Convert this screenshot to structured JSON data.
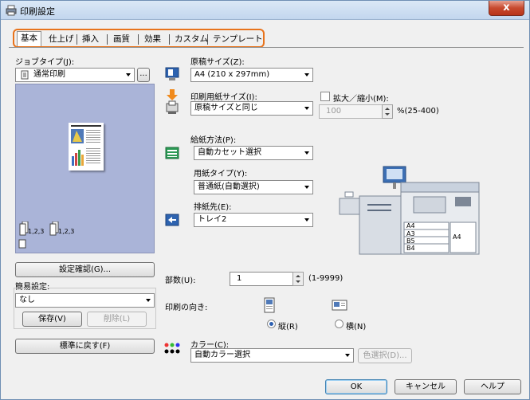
{
  "window": {
    "title": "印刷設定",
    "close_label": "x"
  },
  "tabs": [
    "基本",
    "仕上げ",
    "挿入",
    "画質",
    "効果",
    "カスタム",
    "テンプレート"
  ],
  "left": {
    "job_type_label": "ジョブタイプ(J):",
    "job_type_value": "通常印刷",
    "ellipsis_button": "...",
    "output_label_1": "1,2,3",
    "output_label_2": "1,2,3",
    "confirm_button": "設定確認(G)...",
    "easy_setting_label": "簡易設定:",
    "easy_setting_value": "なし",
    "save_button": "保存(V)",
    "delete_button": "削除(L)",
    "restore_button": "標準に戻す(F)"
  },
  "paper": {
    "original_size_label": "原稿サイズ(Z):",
    "original_size_value": "A4 (210 x 297mm)",
    "print_size_label": "印刷用紙サイズ(I):",
    "print_size_value": "原稿サイズと同じ",
    "zoom_label": "拡大／縮小(M):",
    "zoom_value": "100",
    "zoom_range": "%(25-400)",
    "feed_label": "給紙方法(P):",
    "feed_value": "自動カセット選択",
    "paper_type_label": "用紙タイプ(Y):",
    "paper_type_value": "普通紙(自動選択)",
    "output_label": "排紙先(E):",
    "output_value": "トレイ2"
  },
  "printer_image": {
    "tray_labels": [
      "A4",
      "A3",
      "B5",
      "B4"
    ],
    "side_label": "A4"
  },
  "copies": {
    "label": "部数(U):",
    "value": "1",
    "range": "(1-9999)"
  },
  "orientation": {
    "label": "印刷の向き:",
    "portrait": "縦(R)",
    "landscape": "横(N)",
    "selected": "portrait"
  },
  "color": {
    "label": "カラー(C):",
    "value": "自動カラー選択",
    "select_button": "色選択(D)..."
  },
  "bottom": {
    "ok": "OK",
    "cancel": "キャンセル",
    "help": "ヘルプ"
  },
  "colors": {
    "accent": "#e8731c",
    "preview_bg": "#aab4d8"
  }
}
